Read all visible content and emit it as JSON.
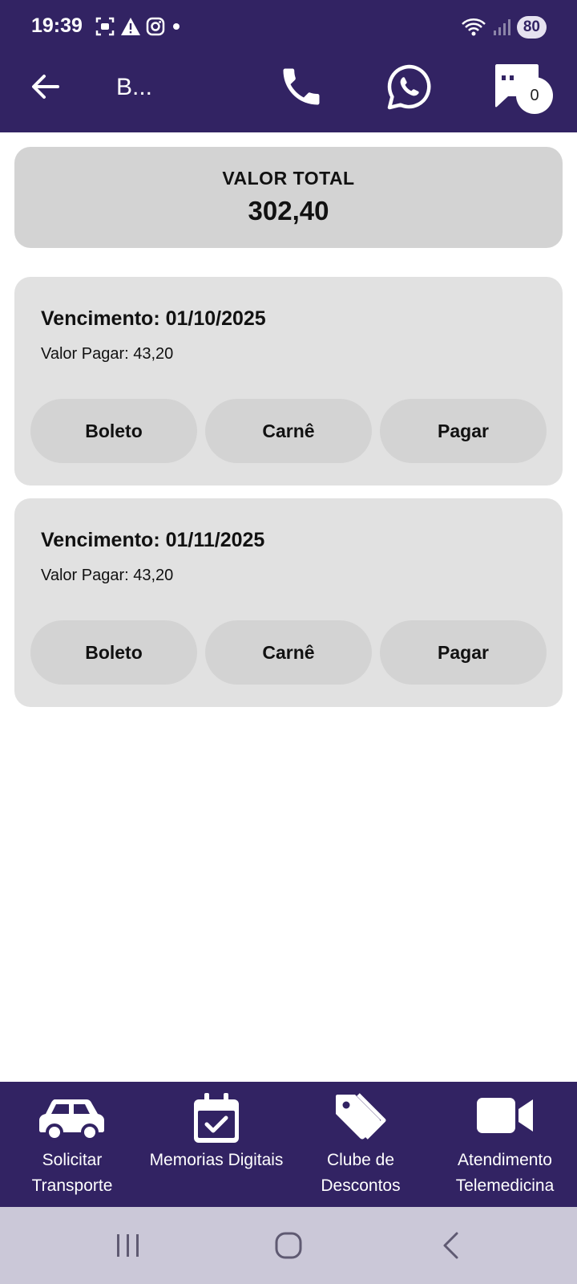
{
  "status_bar": {
    "time": "19:39",
    "battery": "80"
  },
  "app_bar": {
    "title": "B..."
  },
  "chat": {
    "count": "0"
  },
  "total": {
    "label": "VALOR TOTAL",
    "value": "302,40"
  },
  "installments": [
    {
      "due": "Vencimento: 01/10/2025",
      "amount": "Valor Pagar: 43,20",
      "boleto": "Boleto",
      "carne": "Carnê",
      "pagar": "Pagar"
    },
    {
      "due": "Vencimento: 01/11/2025",
      "amount": "Valor Pagar: 43,20",
      "boleto": "Boleto",
      "carne": "Carnê",
      "pagar": "Pagar"
    }
  ],
  "bottom_nav": [
    {
      "label": "Solicitar Transporte",
      "icon": "car-icon"
    },
    {
      "label": "Memorias Digitais",
      "icon": "calendar-check-icon"
    },
    {
      "label": "Clube de Descontos",
      "icon": "tags-icon"
    },
    {
      "label": "Atendimento Telemedicina",
      "icon": "video-camera-icon"
    }
  ],
  "colors": {
    "primary": "#322363",
    "card": "#e1e1e1",
    "button": "#d3d3d3"
  }
}
